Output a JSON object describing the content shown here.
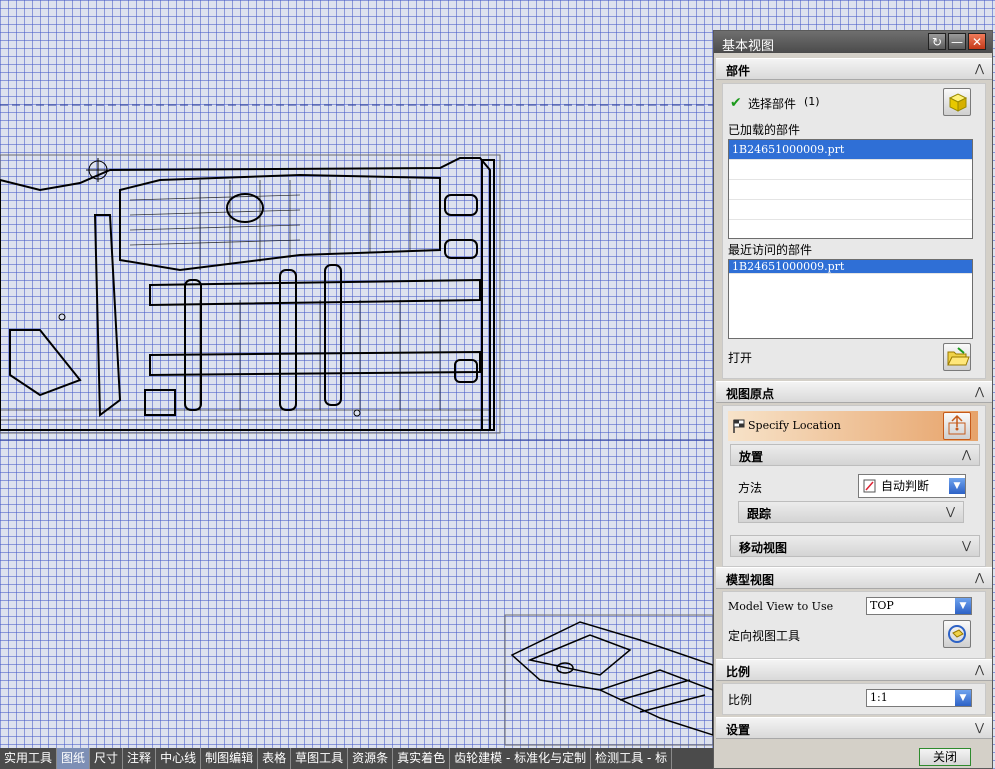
{
  "dialog": {
    "title": "基本视图",
    "title_buttons": {
      "reset": "↻",
      "minimize": "—",
      "close": "✕"
    },
    "sections": {
      "part": "部件",
      "view_origin": "视图原点",
      "model_view": "模型视图",
      "scale": "比例",
      "settings": "设置"
    },
    "part": {
      "select_label": "选择部件",
      "select_count": "(1)",
      "loaded_label": "已加载的部件",
      "loaded_items": [
        "1B24651000009.prt",
        "",
        "",
        "",
        ""
      ],
      "recent_label": "最近访问的部件",
      "recent_items": [
        "1B24651000009.prt"
      ],
      "open_label": "打开"
    },
    "view_origin": {
      "specify_location": "Specify Location",
      "placement_label": "放置",
      "method_label": "方法",
      "method_value": "自动判断",
      "track_label": "跟踪",
      "move_view_label": "移动视图"
    },
    "model_view": {
      "model_view_to_use_label": "Model View to Use",
      "model_view_value": "TOP",
      "orient_tool_label": "定向视图工具"
    },
    "scale": {
      "label": "比例",
      "value": "1:1"
    },
    "close_button": "关闭"
  },
  "toolbar": {
    "tabs": [
      "实用工具",
      "图纸",
      "尺寸",
      "注释",
      "中心线",
      "制图编辑",
      "表格",
      "草图工具",
      "资源条",
      "真实着色",
      "齿轮建模 - 标准化与定制",
      "检测工具 - 标"
    ],
    "active_index": 1
  },
  "colors": {
    "grid_bg": "#dde2ee",
    "grid_line": "#465ac8",
    "selection": "#2f6fd6",
    "specify_gradient_end": "#e7a36a",
    "title_bar": "#4b4b4b"
  },
  "icons": {
    "check": "check-icon",
    "select_part": "cube-icon",
    "open": "folder-icon",
    "location": "flag-icon",
    "location_btn": "point-icon",
    "orient": "orient-view-icon"
  }
}
